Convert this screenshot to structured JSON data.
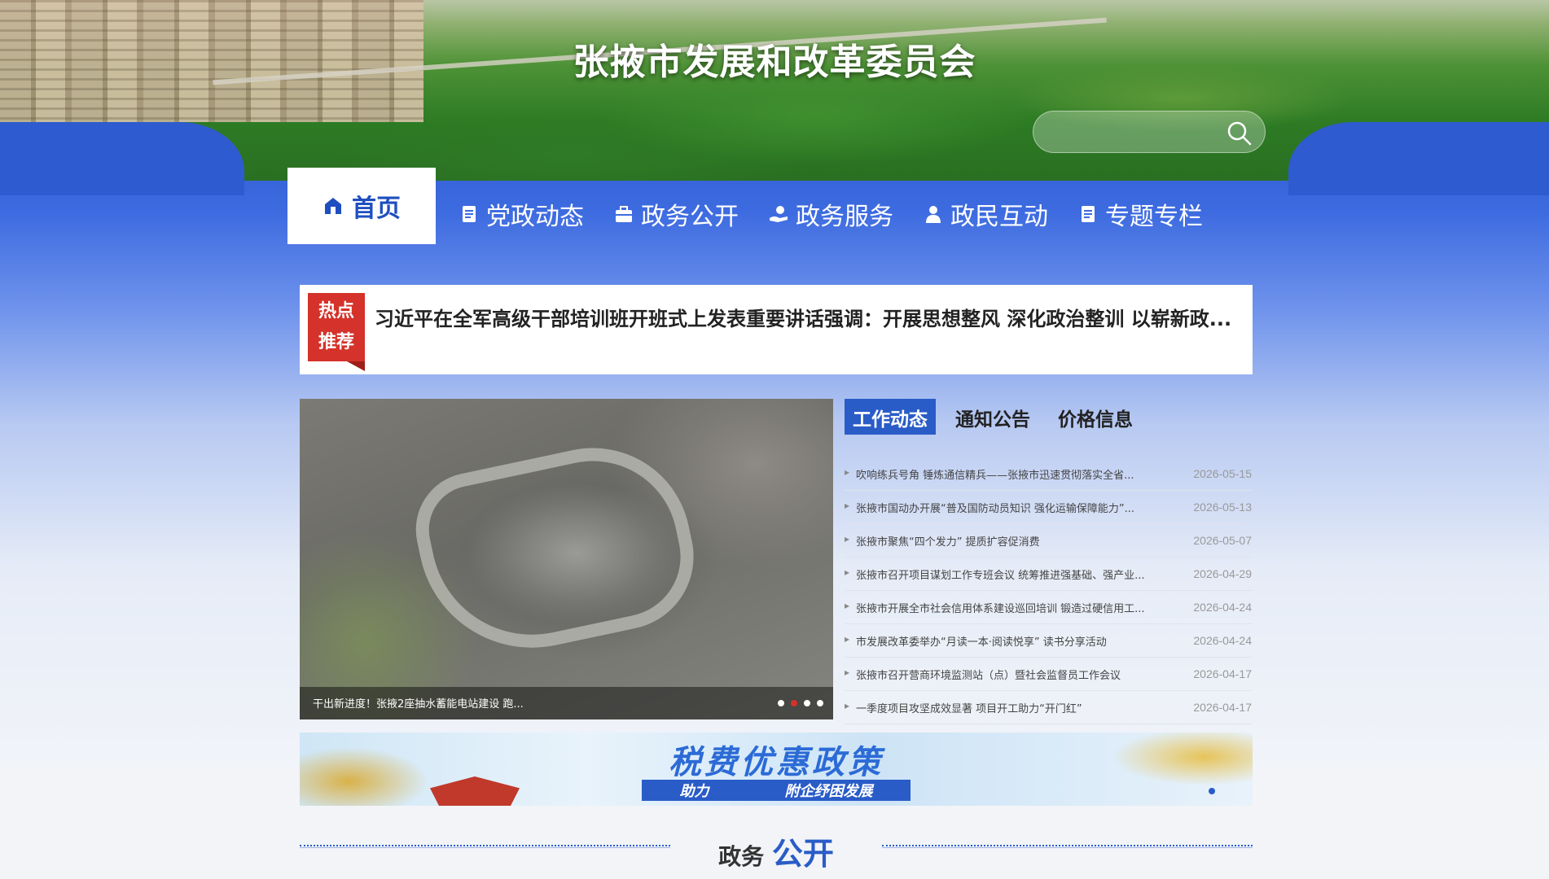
{
  "site": {
    "title": "张掖市发展和改革委员会"
  },
  "search": {
    "placeholder": ""
  },
  "nav": {
    "home": "首页",
    "items": [
      {
        "label": "党政动态",
        "icon": "document-icon"
      },
      {
        "label": "政务公开",
        "icon": "briefcase-icon"
      },
      {
        "label": "政务服务",
        "icon": "hand-service-icon"
      },
      {
        "label": "政民互动",
        "icon": "person-icon"
      },
      {
        "label": "专题专栏",
        "icon": "document-icon"
      }
    ]
  },
  "hot": {
    "badge_line1": "热点",
    "badge_line2": "推荐",
    "headline": "习近平在全军高级干部培训班开班式上发表重要讲话强调：开展思想整风 深化政治整训 以崭新政..."
  },
  "slider": {
    "caption": "干出新进度！张掖2座抽水蓄能电站建设 跑...",
    "dots": 4,
    "active_dot": 2
  },
  "news": {
    "tabs": [
      "工作动态",
      "通知公告",
      "价格信息"
    ],
    "active_tab": 0,
    "items": [
      {
        "title": "吹响练兵号角 锤炼通信精兵——张掖市迅速贯彻落实全省...",
        "date": "2026-05-15"
      },
      {
        "title": "张掖市国动办开展“普及国防动员知识 强化运输保障能力”...",
        "date": "2026-05-13"
      },
      {
        "title": "张掖市聚焦“四个发力” 提质扩容促消费",
        "date": "2026-05-07"
      },
      {
        "title": "张掖市召开项目谋划工作专班会议 统筹推进强基础、强产业...",
        "date": "2026-04-29"
      },
      {
        "title": "张掖市开展全市社会信用体系建设巡回培训 锻造过硬信用工...",
        "date": "2026-04-24"
      },
      {
        "title": "市发展改革委举办“月读一本·阅读悦享” 读书分享活动",
        "date": "2026-04-24"
      },
      {
        "title": "张掖市召开营商环境监测站（点）暨社会监督员工作会议",
        "date": "2026-04-17"
      },
      {
        "title": "一季度项目攻坚成效显著 项目开工助力“开门红”",
        "date": "2026-04-17"
      }
    ]
  },
  "banner": {
    "title": "税费优惠政策",
    "sub_left": "助力",
    "sub_right": "附企纾困发展"
  },
  "section": {
    "title_plain": "政务",
    "title_accent": "公开"
  },
  "colors": {
    "primary": "#2a5cc8",
    "hot_red": "#d4322a"
  }
}
